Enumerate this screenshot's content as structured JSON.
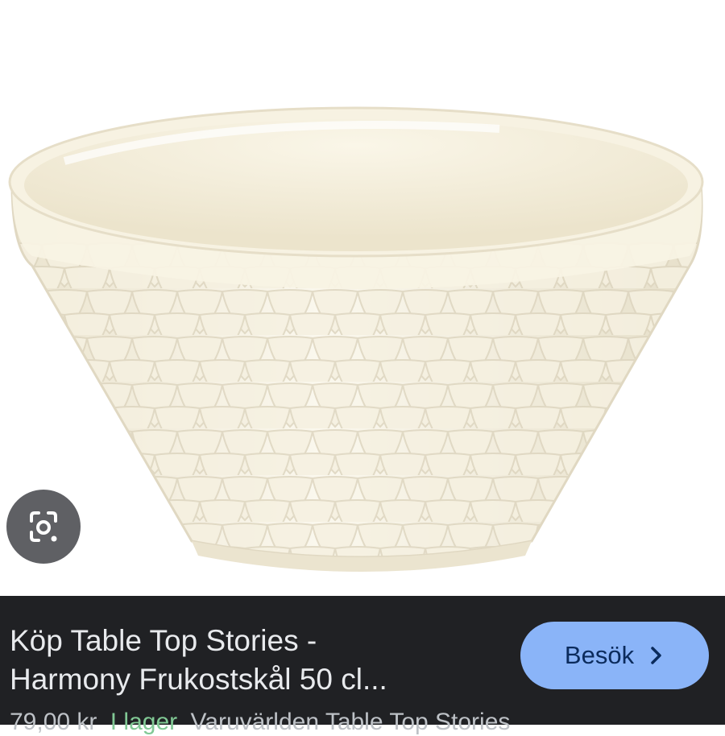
{
  "image": {
    "subject": "product-photo-bowl",
    "lens_icon": "google-lens-icon"
  },
  "result": {
    "title": "Köp Table Top Stories -\nHarmony Frukostskål 50 cl...",
    "visit_button": {
      "label": "Besök",
      "icon": "chevron-right-icon"
    },
    "meta": {
      "price": "79,00 kr",
      "stock": "I lager",
      "source": "Varuvärlden Table Top Stories"
    }
  },
  "colors": {
    "panel_bg": "#202124",
    "button_bg": "#8ab4f8",
    "title_text": "#e8eaed",
    "stock_green": "#81c995"
  }
}
